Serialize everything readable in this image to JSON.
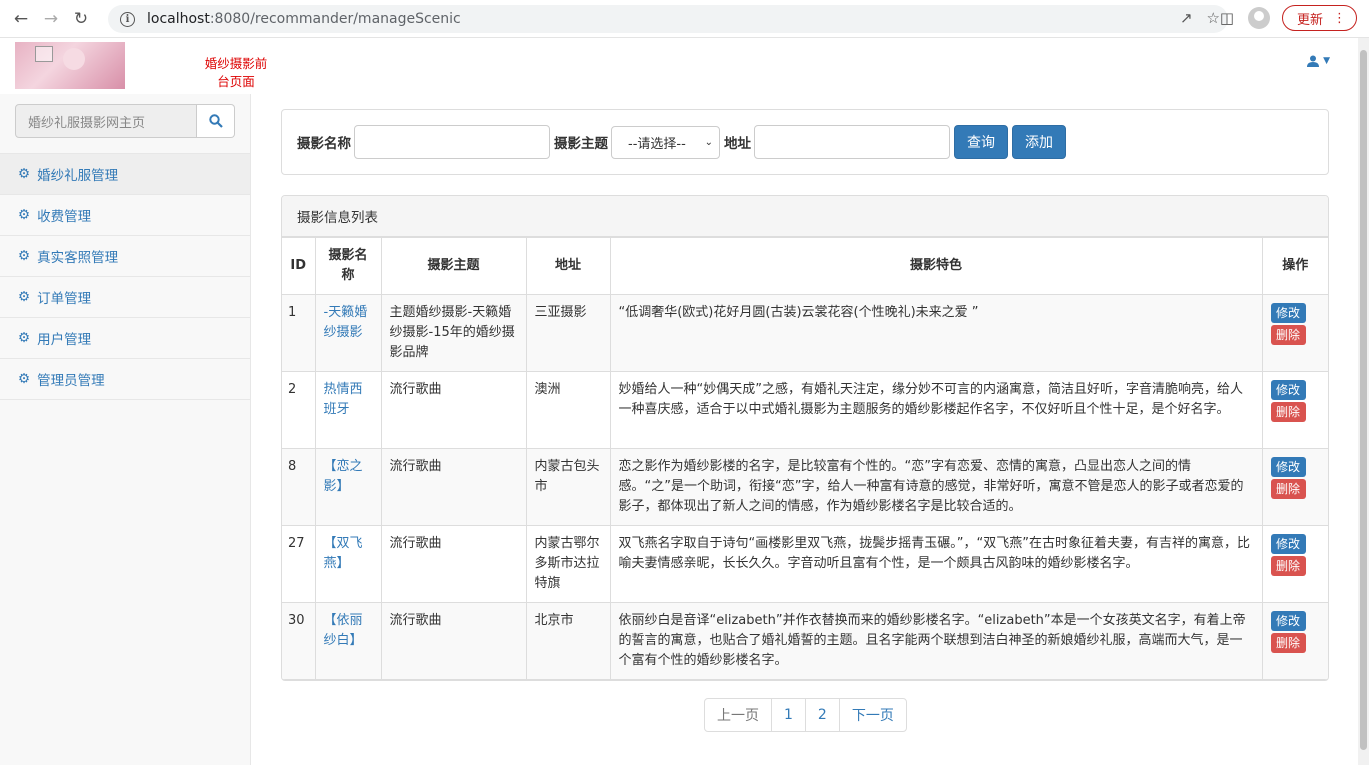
{
  "browser": {
    "url_host": "localhost",
    "url_rest": ":8080/recommander/manageScenic",
    "update_label": "更新"
  },
  "header": {
    "front_link": "婚纱摄影前台页面"
  },
  "sidebar": {
    "search_placeholder": "婚纱礼服摄影网主页",
    "items": [
      {
        "label": "婚纱礼服管理"
      },
      {
        "label": "收费管理"
      },
      {
        "label": "真实客照管理"
      },
      {
        "label": "订单管理"
      },
      {
        "label": "用户管理"
      },
      {
        "label": "管理员管理"
      }
    ]
  },
  "filter": {
    "name_label": "摄影名称",
    "theme_label": "摄影主题",
    "theme_select": "--请选择--",
    "address_label": "地址",
    "query_button": "查询",
    "add_button": "添加"
  },
  "list": {
    "heading": "摄影信息列表",
    "columns": [
      "ID",
      "摄影名称",
      "摄影主题",
      "地址",
      "摄影特色",
      "操作"
    ],
    "edit_label": "修改",
    "delete_label": "删除",
    "rows": [
      {
        "id": "1",
        "name": "-天籁婚纱摄影",
        "theme": "主题婚纱摄影-天籁婚纱摄影-15年的婚纱摄影品牌",
        "address": "三亚摄影",
        "feature": "“低调奢华(欧式)花好月圆(古装)云裳花容(个性晚礼)未来之爱 ”"
      },
      {
        "id": "2",
        "name": "热情西班牙",
        "theme": "流行歌曲",
        "address": "澳洲",
        "feature": "妙婚给人一种“妙偶天成”之感，有婚礼天注定，缘分妙不可言的内涵寓意，简洁且好听，字音清脆响亮，给人一种喜庆感，适合于以中式婚礼摄影为主题服务的婚纱影楼起作名字，不仅好听且个性十足，是个好名字。"
      },
      {
        "id": "8",
        "name": "【恋之影】",
        "theme": "流行歌曲",
        "address": "内蒙古包头市",
        "feature": "恋之影作为婚纱影楼的名字，是比较富有个性的。“恋”字有恋爱、恋情的寓意，凸显出恋人之间的情感。“之”是一个助词，衔接“恋”字，给人一种富有诗意的感觉，非常好听，寓意不管是恋人的影子或者恋爱的影子，都体现出了新人之间的情感，作为婚纱影楼名字是比较合适的。"
      },
      {
        "id": "27",
        "name": "【双飞燕】",
        "theme": "流行歌曲",
        "address": "内蒙古鄂尔多斯市达拉特旗",
        "feature": "双飞燕名字取自于诗句“画楼影里双飞燕，拢鬓步摇青玉碾。”，“双飞燕”在古时象征着夫妻，有吉祥的寓意，比喻夫妻情感亲昵，长长久久。字音动听且富有个性，是一个颇具古风韵味的婚纱影楼名字。"
      },
      {
        "id": "30",
        "name": "【依丽纱白】",
        "theme": "流行歌曲",
        "address": "北京市",
        "feature": "依丽纱白是音译“elizabeth”并作衣替换而来的婚纱影楼名字。“elizabeth”本是一个女孩英文名字，有着上帝的誓言的寓意，也贴合了婚礼婚誓的主题。且名字能两个联想到洁白神圣的新娘婚纱礼服，高端而大气，是一个富有个性的婚纱影楼名字。"
      }
    ]
  },
  "pager": {
    "prev": "上一页",
    "pages": [
      "1",
      "2"
    ],
    "next": "下一页"
  }
}
